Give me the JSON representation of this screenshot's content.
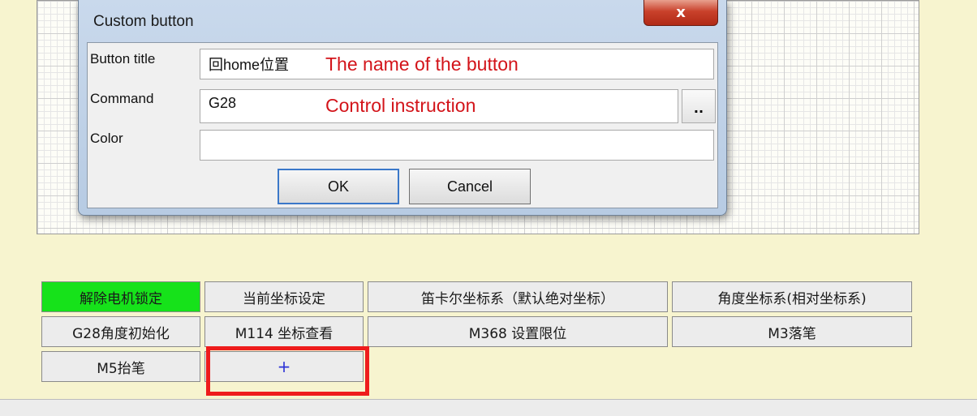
{
  "dialog": {
    "title": "Custom button",
    "close_label": "x",
    "fields": {
      "button_title": {
        "label": "Button title",
        "value": "回home位置",
        "note": "The name of the button"
      },
      "command": {
        "label": "Command",
        "value": "G28",
        "note": "Control instruction",
        "browse_label": ".."
      },
      "color": {
        "label": "Color",
        "value": ""
      }
    },
    "ok_label": "OK",
    "cancel_label": "Cancel"
  },
  "panel": {
    "buttons": [
      {
        "label": "解除电机锁定",
        "color": "#16e21a"
      },
      {
        "label": "当前坐标设定"
      },
      {
        "label": "笛卡尔坐标系（默认绝对坐标）"
      },
      {
        "label": "角度坐标系(相对坐标系)"
      },
      {
        "label": "G28角度初始化"
      },
      {
        "label": "M114 坐标查看"
      },
      {
        "label": "M368  设置限位"
      },
      {
        "label": "M3落笔"
      },
      {
        "label": "M5抬笔"
      },
      {
        "label": "+"
      }
    ]
  },
  "colors": {
    "background": "#f7f4cf",
    "highlight": "#ee1c1c",
    "note_text": "#d3141a",
    "add_button_text": "#2d33d6"
  }
}
